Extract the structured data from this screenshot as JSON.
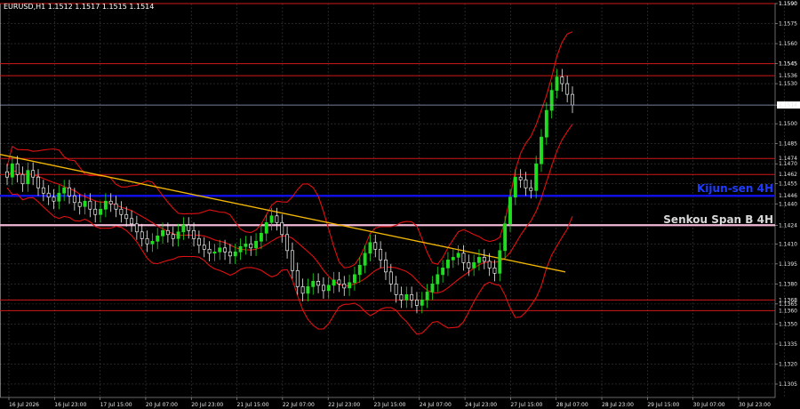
{
  "chart_data": {
    "type": "candlestick",
    "title": "EURUSD,H1  1.1512 1.1517 1.1515 1.1514",
    "y_range": [
      1.1295,
      1.159
    ],
    "y_ticks": [
      "1.1590",
      "1.1575",
      "1.1560",
      "1.1545",
      "1.1530",
      "1.1514",
      "1.1500",
      "1.1485",
      "1.1470",
      "1.1455",
      "1.1440",
      "1.1424",
      "1.1410",
      "1.1395",
      "1.1380",
      "1.1365",
      "1.1350",
      "1.1335",
      "1.1320",
      "1.1305"
    ],
    "x_labels": [
      "16 Jul 2026",
      "16 Jul 23:00",
      "17 Jul 15:00",
      "20 Jul 07:00",
      "20 Jul 23:00",
      "21 Jul 15:00",
      "22 Jul 07:00",
      "22 Jul 23:00",
      "23 Jul 15:00",
      "24 Jul 07:00",
      "24 Jul 23:00",
      "27 Jul 15:00",
      "28 Jul 07:00",
      "28 Jul 23:00",
      "29 Jul 15:00",
      "30 Jul 07:00",
      "30 Jul 23:00"
    ],
    "current_price": "1.1514",
    "levels": {
      "red": [
        1.159,
        1.1545,
        1.1536,
        1.1474,
        1.1462,
        1.1368,
        1.136
      ],
      "kijun_sen": 1.1446,
      "senkou_span_b": 1.1424
    },
    "annotations": {
      "kijun_label": "Kijun-sen 4H",
      "senkou_label": "Senkou Span B 4H"
    },
    "trendline": {
      "from": 1.1477,
      "to": 1.1389
    },
    "candles_close_path": [
      1.146,
      1.147,
      1.1462,
      1.1455,
      1.1465,
      1.146,
      1.1452,
      1.1448,
      1.1445,
      1.1442,
      1.1448,
      1.1452,
      1.1446,
      1.1441,
      1.1438,
      1.1442,
      1.1436,
      1.1432,
      1.1436,
      1.1442,
      1.144,
      1.1436,
      1.1432,
      1.1429,
      1.1425,
      1.1419,
      1.1414,
      1.141,
      1.1412,
      1.1416,
      1.142,
      1.1417,
      1.1414,
      1.1419,
      1.1424,
      1.142,
      1.1414,
      1.1409,
      1.1406,
      1.1403,
      1.1404,
      1.1407,
      1.1404,
      1.1401,
      1.1404,
      1.1408,
      1.141,
      1.1407,
      1.1412,
      1.1418,
      1.1426,
      1.1431,
      1.1426,
      1.1417,
      1.1405,
      1.139,
      1.1378,
      1.1373,
      1.1378,
      1.1382,
      1.1379,
      1.1375,
      1.1379,
      1.1383,
      1.138,
      1.1377,
      1.1381,
      1.1387,
      1.1394,
      1.1403,
      1.1411,
      1.1406,
      1.1398,
      1.1389,
      1.138,
      1.1372,
      1.1368,
      1.1372,
      1.1368,
      1.1364,
      1.1368,
      1.1374,
      1.138,
      1.1387,
      1.1392,
      1.1398,
      1.14,
      1.1403,
      1.1396,
      1.1392,
      1.1396,
      1.14,
      1.1397,
      1.1392,
      1.1388,
      1.1405,
      1.1425,
      1.1445,
      1.146,
      1.1458,
      1.1452,
      1.145,
      1.147,
      1.149,
      1.151,
      1.1525,
      1.1535,
      1.153,
      1.1522,
      1.1514
    ]
  }
}
